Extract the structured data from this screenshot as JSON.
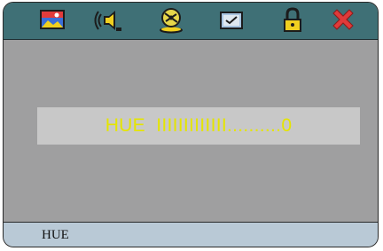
{
  "toolbar": {
    "items": [
      {
        "icon": "picture-icon"
      },
      {
        "icon": "speaker-icon"
      },
      {
        "icon": "disc-icon"
      },
      {
        "icon": "display-check-icon"
      },
      {
        "icon": "lock-icon"
      },
      {
        "icon": "close-icon"
      }
    ]
  },
  "hue_setting": {
    "label": "HUE",
    "ticks": "IIIIIIIIIIIII",
    "dots": "..........",
    "value": "0"
  },
  "status": {
    "text": "HUE"
  },
  "colors": {
    "toolbar_bg": "#3f7076",
    "panel_bg": "#9f9fa0",
    "bar_bg": "#c8c8c8",
    "bar_text": "#e5e500",
    "status_bg": "#b9c9d6",
    "close_accent": "#e03a3a"
  }
}
